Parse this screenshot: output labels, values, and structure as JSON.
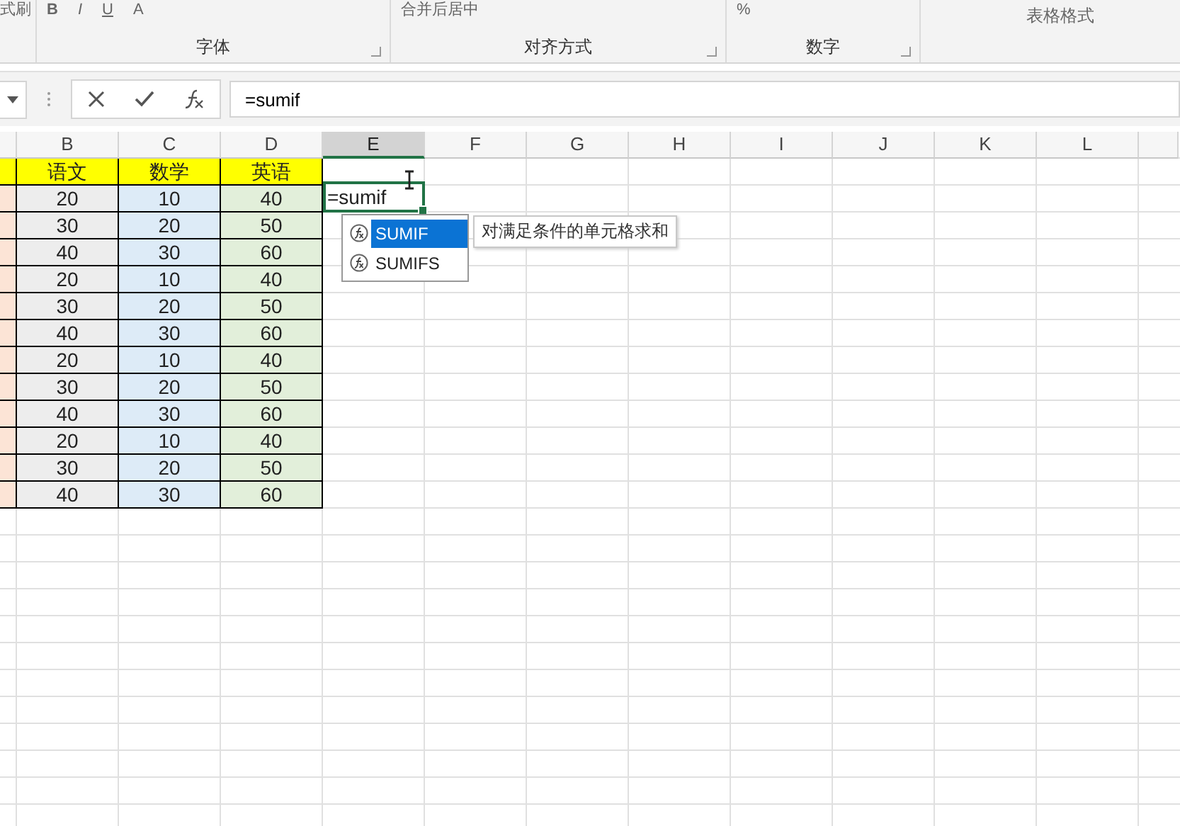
{
  "ribbon": {
    "clipboard": {
      "label": "式刷"
    },
    "groups": [
      {
        "label": "字体",
        "buttons": [
          {
            "label": "B",
            "kind": "bold"
          },
          {
            "label": "I",
            "kind": "italic"
          },
          {
            "label": "U",
            "kind": "underline"
          },
          {
            "label": "A",
            "kind": "text"
          }
        ]
      },
      {
        "label": "对齐方式",
        "buttons": [
          {
            "label": "合并后居中",
            "kind": "text"
          }
        ]
      },
      {
        "label": "数字",
        "buttons": [
          {
            "label": "%",
            "kind": "text"
          }
        ]
      }
    ],
    "styles": {
      "label": "表格格式"
    }
  },
  "formula_bar": {
    "value": "=sumif"
  },
  "sheet": {
    "columns": [
      {
        "selected": false
      },
      {
        "label": "B",
        "selected": false
      },
      {
        "label": "C",
        "selected": false
      },
      {
        "label": "D",
        "selected": false
      },
      {
        "label": "E",
        "selected": true
      },
      {
        "label": "F",
        "selected": false
      },
      {
        "label": "G",
        "selected": false
      },
      {
        "label": "H",
        "selected": false
      },
      {
        "label": "I",
        "selected": false
      },
      {
        "label": "J",
        "selected": false
      },
      {
        "label": "K",
        "selected": false
      },
      {
        "label": "L",
        "selected": false
      },
      {
        "selected": false
      }
    ],
    "table": {
      "columns": [
        {
          "color": "#fce4d6"
        },
        {
          "header": "语文",
          "color": "#ededed"
        },
        {
          "header": "数学",
          "color": "#ddebf7"
        },
        {
          "header": "英语",
          "color": "#e2efda"
        }
      ],
      "rows": [
        [
          "",
          "20",
          "10",
          "40"
        ],
        [
          "",
          "30",
          "20",
          "50"
        ],
        [
          "",
          "40",
          "30",
          "60"
        ],
        [
          "",
          "20",
          "10",
          "40"
        ],
        [
          "",
          "30",
          "20",
          "50"
        ],
        [
          "",
          "40",
          "30",
          "60"
        ],
        [
          "",
          "20",
          "10",
          "40"
        ],
        [
          "",
          "30",
          "20",
          "50"
        ],
        [
          "",
          "40",
          "30",
          "60"
        ],
        [
          "",
          "20",
          "10",
          "40"
        ],
        [
          "",
          "30",
          "20",
          "50"
        ],
        [
          "",
          "40",
          "30",
          "60"
        ]
      ]
    },
    "edit_cell": {
      "text": "=sumif"
    }
  },
  "autocomplete": {
    "items": [
      {
        "label": "SUMIF",
        "selected": true
      },
      {
        "label": "SUMIFS",
        "selected": false
      }
    ],
    "tooltip": "对满足条件的单元格求和"
  }
}
